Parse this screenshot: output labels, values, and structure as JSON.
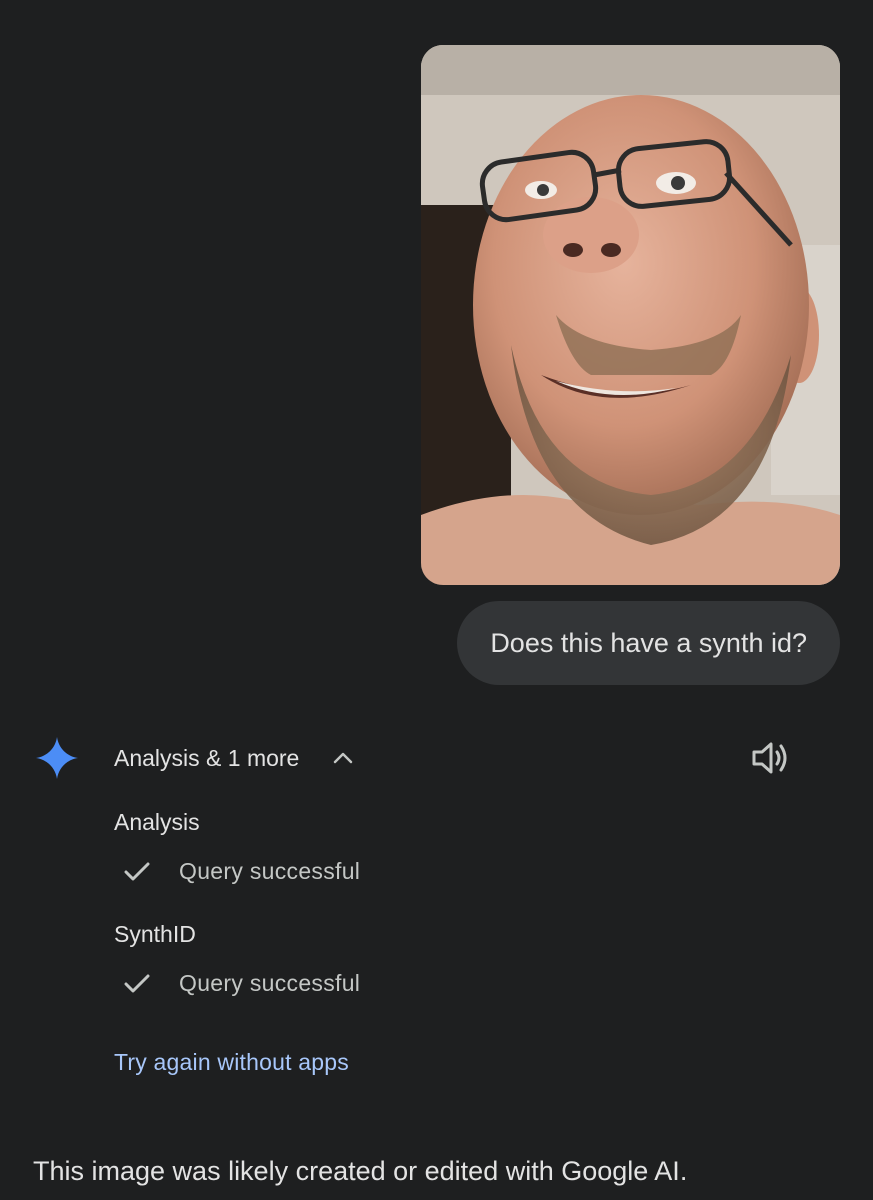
{
  "attachment": {
    "type": "image",
    "icon": "face-photo"
  },
  "user_message": {
    "text": "Does this have a synth id?"
  },
  "assistant": {
    "icon": "gemini-sparkle-icon",
    "accent_color": "#4c8df6",
    "tools_summary": "Analysis & 1 more",
    "tools_expanded": true,
    "tools": [
      {
        "name": "Analysis",
        "status": "Query successful"
      },
      {
        "name": "SynthID",
        "status": "Query successful"
      }
    ],
    "retry_link": "Try again without apps",
    "link_color": "#a8c7fa",
    "response_text": "This image was likely created or edited with Google AI."
  }
}
